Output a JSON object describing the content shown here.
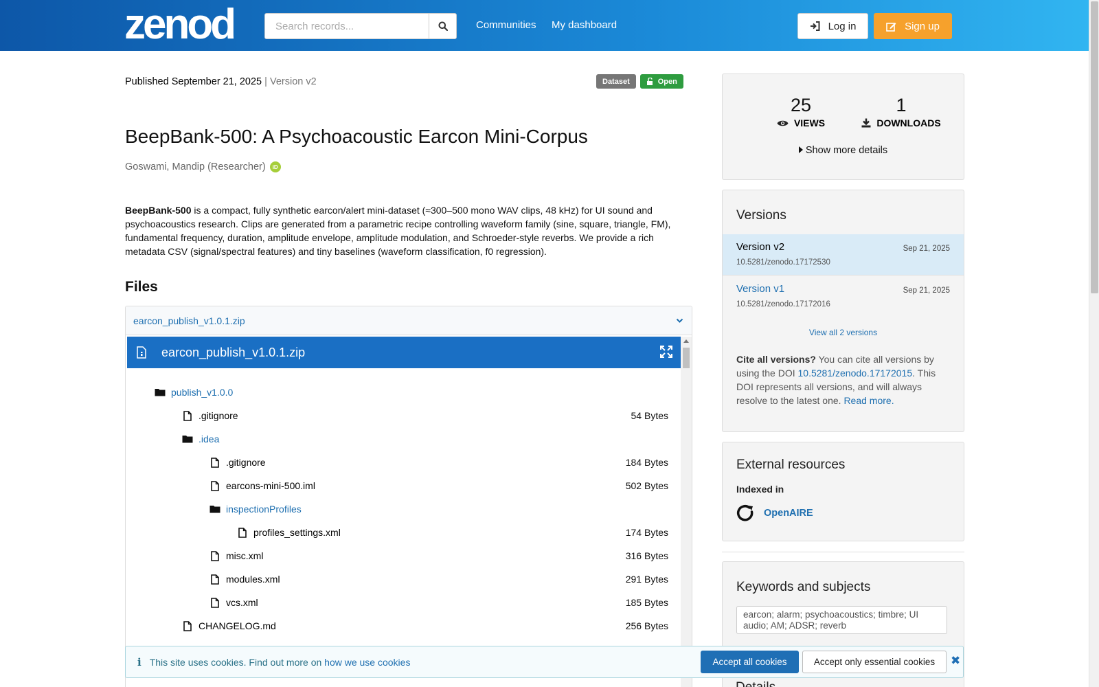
{
  "header": {
    "logo_text": "zenodo",
    "search_placeholder": "Search records...",
    "nav": [
      "Communities",
      "My dashboard"
    ],
    "login_label": "Log in",
    "signup_label": "Sign up"
  },
  "record": {
    "published": "Published September 21, 2025",
    "separator": "|",
    "version": "Version v2",
    "badge_type": "Dataset",
    "badge_access": "Open",
    "title": "BeepBank-500: A Psychoacoustic Earcon Mini-Corpus",
    "author": "Goswami, Mandip (Researcher)",
    "orcid_label": "iD",
    "description_bold": "BeepBank-500",
    "description_rest": " is a compact, fully synthetic earcon/alert mini-dataset (≈300–500 mono WAV clips, 48 kHz) for UI sound and psychoacoustics research. Clips are generated from a parametric recipe controlling waveform family (sine, square, triangle, FM), fundamental frequency, duration, amplitude envelope, amplitude modulation, and Schroeder-style reverbs. We provide a rich metadata CSV (signal/spectral features) and tiny baselines (waveform classification, f0 regression)."
  },
  "files": {
    "heading": "Files",
    "archive_name": "earcon_publish_v1.0.1.zip",
    "preview_title": "earcon_publish_v1.0.1.zip",
    "tree": [
      {
        "name": "publish_v1.0.0",
        "type": "folder",
        "depth": 1,
        "size": ""
      },
      {
        "name": ".gitignore",
        "type": "file",
        "depth": 2,
        "size": "54 Bytes"
      },
      {
        "name": ".idea",
        "type": "folder",
        "depth": 2,
        "size": ""
      },
      {
        "name": ".gitignore",
        "type": "file",
        "depth": 3,
        "size": "184 Bytes"
      },
      {
        "name": "earcons-mini-500.iml",
        "type": "file",
        "depth": 3,
        "size": "502 Bytes"
      },
      {
        "name": "inspectionProfiles",
        "type": "folder",
        "depth": 3,
        "size": ""
      },
      {
        "name": "profiles_settings.xml",
        "type": "file",
        "depth": 4,
        "size": "174 Bytes"
      },
      {
        "name": "misc.xml",
        "type": "file",
        "depth": 3,
        "size": "316 Bytes"
      },
      {
        "name": "modules.xml",
        "type": "file",
        "depth": 3,
        "size": "291 Bytes"
      },
      {
        "name": "vcs.xml",
        "type": "file",
        "depth": 3,
        "size": "185 Bytes"
      },
      {
        "name": "CHANGELOG.md",
        "type": "file",
        "depth": 2,
        "size": "256 Bytes"
      }
    ]
  },
  "stats": {
    "views": "25",
    "views_label": "VIEWS",
    "downloads": "1",
    "downloads_label": "DOWNLOADS",
    "more_details": "Show more details"
  },
  "versions": {
    "heading": "Versions",
    "items": [
      {
        "name": "Version v2",
        "date": "Sep 21, 2025",
        "doi": "10.5281/zenodo.17172530",
        "active": true
      },
      {
        "name": "Version v1",
        "date": "Sep 21, 2025",
        "doi": "10.5281/zenodo.17172016",
        "active": false
      }
    ],
    "view_all": "View all 2 versions",
    "cite_bold": "Cite all versions?",
    "cite_text_1": " You can cite all versions by using the DOI ",
    "cite_doi": "10.5281/zenodo.17172015",
    "cite_text_2": ". This DOI represents all versions, and will always resolve to the latest one. ",
    "read_more": "Read more."
  },
  "external": {
    "heading": "External resources",
    "indexed_in": "Indexed in",
    "resource": "OpenAIRE"
  },
  "keywords": {
    "heading": "Keywords and subjects",
    "value": "earcon; alarm; psychoacoustics; timbre; UI audio; AM; ADSR; reverb"
  },
  "details_heading": "Details",
  "cookie": {
    "text": "This site uses cookies. Find out more on ",
    "link": "how we use cookies",
    "accept_all": "Accept all cookies",
    "accept_essential": "Accept only essential cookies"
  }
}
